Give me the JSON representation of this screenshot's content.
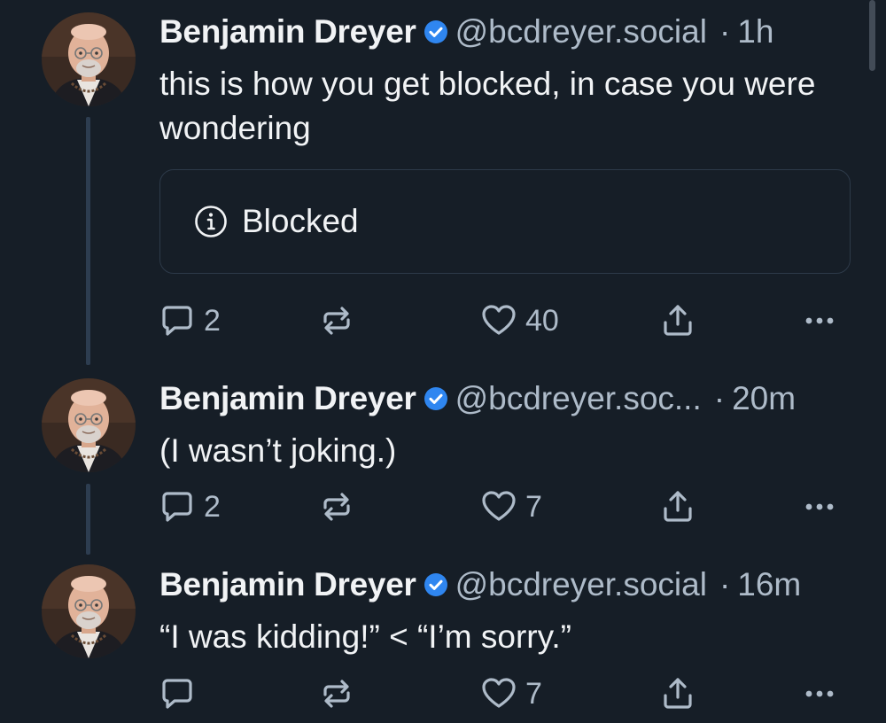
{
  "colors": {
    "background": "#161e27",
    "text_primary": "#f1f3f5",
    "text_secondary": "#aebbc9",
    "verified_badge": "#2f86f0",
    "thread_line": "#2d3d50"
  },
  "posts": [
    {
      "author_name": "Benjamin Dreyer",
      "handle": "@bcdreyer.social",
      "separator": "·",
      "time": "1h",
      "text": "this is how you get blocked, in case you were wondering",
      "embed": {
        "icon": "info-icon",
        "label": "Blocked"
      },
      "reply_count": "2",
      "like_count": "40"
    },
    {
      "author_name": "Benjamin Dreyer",
      "handle": "@bcdreyer.soc...",
      "separator": "·",
      "time": "20m",
      "text": "(I wasn’t joking.)",
      "reply_count": "2",
      "like_count": "7"
    },
    {
      "author_name": "Benjamin Dreyer",
      "handle": "@bcdreyer.social",
      "separator": "·",
      "time": "16m",
      "text": "“I was kidding!” < “I’m sorry.”",
      "reply_count": "",
      "like_count": "7"
    }
  ],
  "icons": [
    "verified-icon",
    "reply-icon",
    "repost-icon",
    "like-icon",
    "share-icon",
    "more-icon",
    "info-icon"
  ]
}
